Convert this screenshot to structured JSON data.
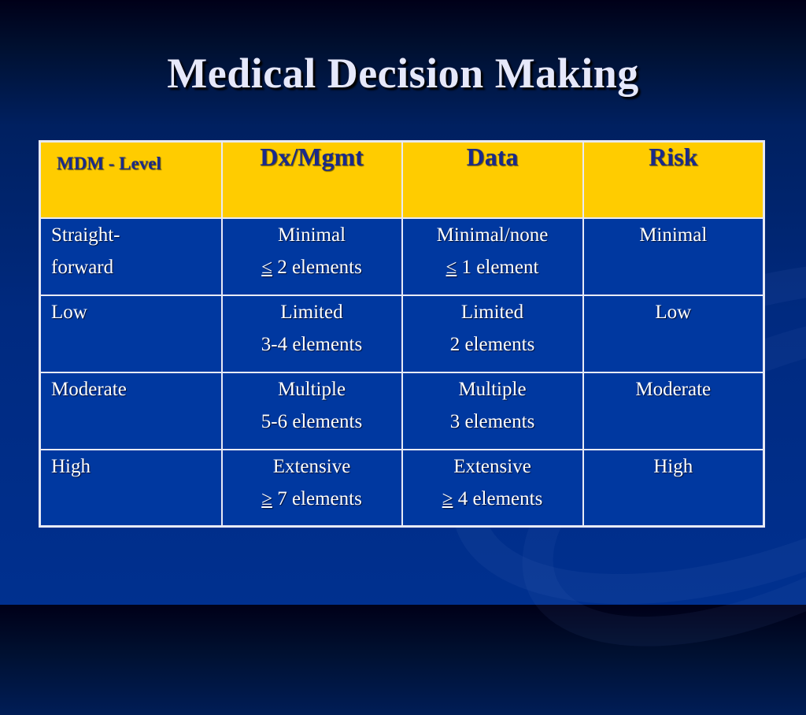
{
  "slide": {
    "title": "Medical Decision Making"
  },
  "table": {
    "headers": [
      "MDM - Level",
      "Dx/Mgmt",
      "Data",
      "Risk"
    ],
    "rows": [
      {
        "level": [
          "Straight-",
          "forward"
        ],
        "dx_mgmt": {
          "label": "Minimal",
          "prefix": "≤",
          "count": " 2 elements"
        },
        "data": {
          "label": "Minimal/none",
          "prefix": "≤",
          "count": " 1 element"
        },
        "risk": "Minimal"
      },
      {
        "level": [
          "Low"
        ],
        "dx_mgmt": {
          "label": "Limited",
          "prefix": "",
          "count": "3-4 elements"
        },
        "data": {
          "label": "Limited",
          "prefix": "",
          "count": "2 elements"
        },
        "risk": "Low"
      },
      {
        "level": [
          "Moderate"
        ],
        "dx_mgmt": {
          "label": "Multiple",
          "prefix": "",
          "count": "5-6 elements"
        },
        "data": {
          "label": "Multiple",
          "prefix": "",
          "count": "3 elements"
        },
        "risk": "Moderate"
      },
      {
        "level": [
          "High"
        ],
        "dx_mgmt": {
          "label": "Extensive",
          "prefix": "≥",
          "count": " 7 elements"
        },
        "data": {
          "label": "Extensive",
          "prefix": "≥",
          "count": " 4 elements"
        },
        "risk": "High"
      }
    ]
  },
  "colors": {
    "header_bg": "#ffcc00",
    "header_text": "#1a2a8a",
    "cell_bg": "#0038a0",
    "cell_text": "#ffffff",
    "title_text": "#e6e8fa"
  }
}
